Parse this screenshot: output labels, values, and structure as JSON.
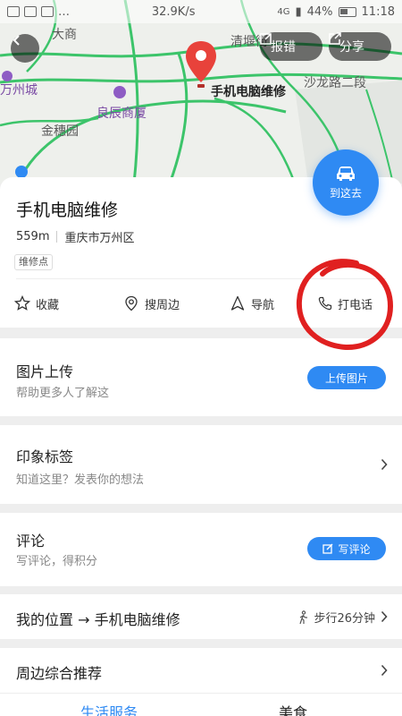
{
  "status_bar": {
    "speed": "32.9K/s",
    "signal_4g": "4G",
    "battery": "44%",
    "time": "11:18"
  },
  "map": {
    "labels": {
      "wanzhou_city": "万州城",
      "liangchen_plaza": "良辰商厦",
      "jinsui_garden": "金穗园",
      "qingyan_street": "清堰街",
      "shalong_road": "沙龙路二段",
      "pin_label": "手机电脑维修",
      "partial_top": "大商"
    },
    "report_label": "报错",
    "share_label": "分享"
  },
  "go_button": {
    "label": "到这去"
  },
  "place": {
    "name": "手机电脑维修",
    "distance": "559m",
    "area": "重庆市万州区",
    "tag": "维修点"
  },
  "actions": {
    "favorite": "收藏",
    "nearby": "搜周边",
    "navigate": "导航",
    "call": "打电话"
  },
  "photo_section": {
    "title": "图片上传",
    "subtitle": "帮助更多人了解这",
    "button": "上传图片"
  },
  "impression_section": {
    "title": "印象标签",
    "subtitle": "知道这里？发表你的想法"
  },
  "review_section": {
    "title": "评论",
    "subtitle": "写评论，得积分",
    "button": "写评论"
  },
  "route_section": {
    "title": "我的位置 → 手机电脑维修",
    "walk": "步行26分钟"
  },
  "nearby_section": {
    "title": "周边综合推荐"
  },
  "tabs": {
    "life": "生活服务",
    "food": "美食"
  },
  "colors": {
    "accent": "#2f8af3",
    "pin_red": "#e8423b",
    "annotation_red": "#e02020"
  }
}
